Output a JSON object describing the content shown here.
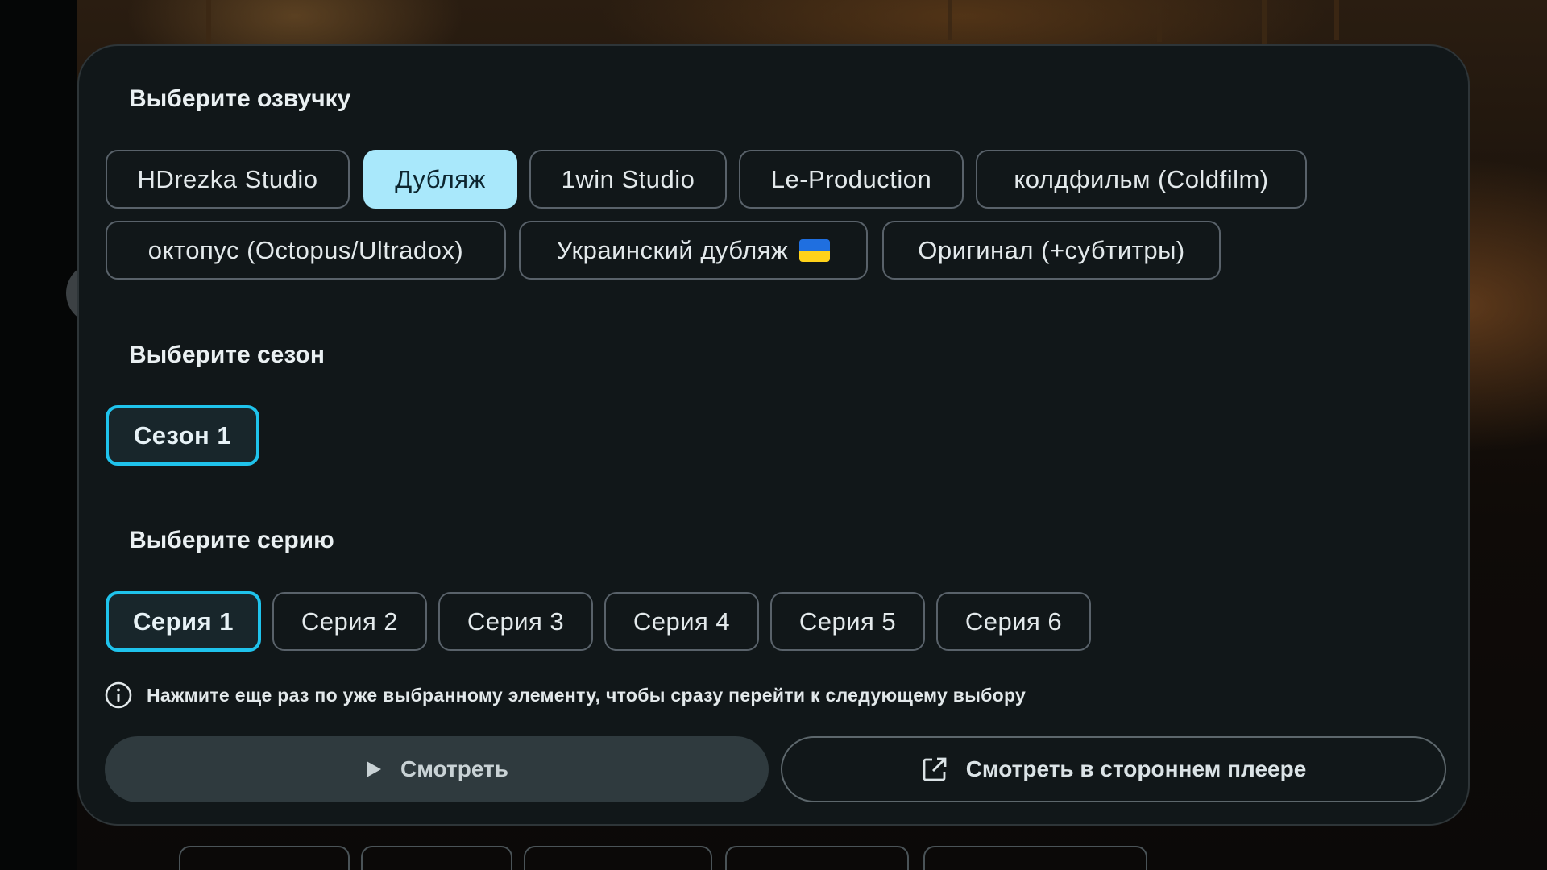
{
  "dialog": {
    "dubbing": {
      "title": "Выберите озвучку",
      "options": [
        "HDrezka Studio",
        "Дубляж",
        "1win Studio",
        "Le-Production",
        "колдфильм (Coldfilm)",
        "октопус (Octopus/Ultradox)",
        "Украинский дубляж",
        "Оригинал (+субтитры)"
      ],
      "selected": "Дубляж"
    },
    "season": {
      "title": "Выберите сезон",
      "options": [
        "Сезон 1"
      ],
      "selected": "Сезон 1"
    },
    "episode": {
      "title": "Выберите серию",
      "options": [
        "Серия 1",
        "Серия 2",
        "Серия 3",
        "Серия 4",
        "Серия 5",
        "Серия 6"
      ],
      "selected": "Серия 1"
    },
    "hint": "Нажмите еще раз по уже выбранному элементу, чтобы сразу перейти к следующему выбору",
    "buttons": {
      "watch": "Смотреть",
      "external": "Смотреть в стороннем плеере"
    }
  },
  "colors": {
    "accent_focus": "#1fc3ec",
    "accent_fill": "#a9e8fb",
    "dialog_bg": "#111719"
  },
  "icons": [
    "play-icon",
    "open-external-icon",
    "info-icon",
    "ukraine-flag-icon"
  ]
}
